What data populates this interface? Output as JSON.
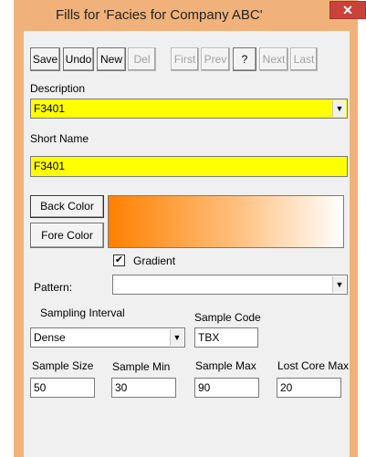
{
  "window": {
    "title": "Fills for 'Facies for Company ABC'",
    "close_glyph": "✕"
  },
  "toolbar": {
    "save": "Save",
    "undo": "Undo",
    "new": "New",
    "del": "Del",
    "first": "First",
    "prev": "Prev",
    "help": "?",
    "next": "Next",
    "last": "Last"
  },
  "description": {
    "label": "Description",
    "value": "F3401"
  },
  "short_name": {
    "label": "Short Name",
    "value": "F3401"
  },
  "colors": {
    "back_color_label": "Back Color",
    "fore_color_label": "Fore Color",
    "gradient_label": "Gradient",
    "gradient_checked": "✔",
    "back_color": "#ff8000",
    "fore_color": "#ffffff"
  },
  "pattern": {
    "label": "Pattern:",
    "value": ""
  },
  "sampling_interval": {
    "label": "Sampling Interval",
    "value": "Dense"
  },
  "sample_code": {
    "label": "Sample Code",
    "value": "TBX"
  },
  "sample_size": {
    "label": "Sample Size",
    "value": "50"
  },
  "sample_min": {
    "label": "Sample Min",
    "value": "30"
  },
  "sample_max": {
    "label": "Sample Max",
    "value": "90"
  },
  "lost_core_max": {
    "label": "Lost Core Max",
    "value": "20"
  },
  "icons": {
    "dropdown": "▼"
  }
}
